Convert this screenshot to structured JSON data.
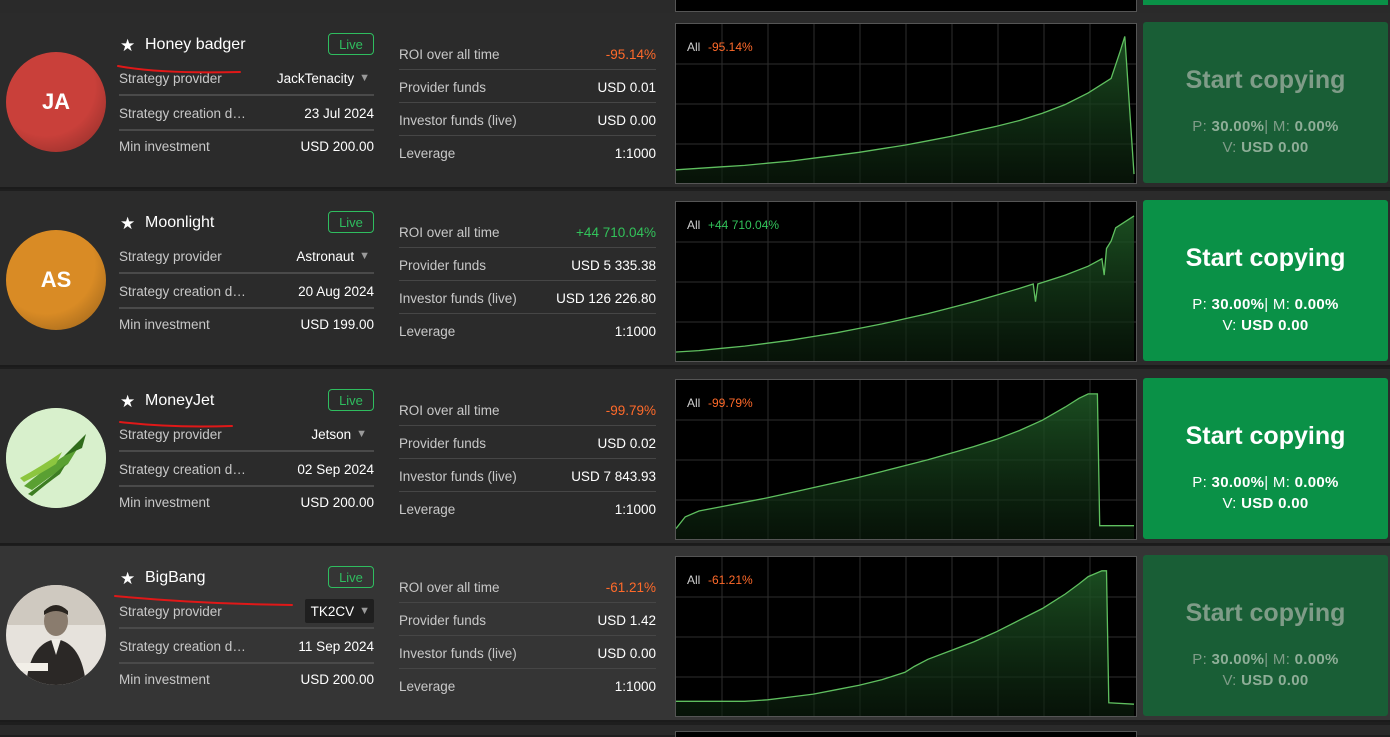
{
  "labels": {
    "strategy_provider": "Strategy provider",
    "strategy_creation": "Strategy creation date",
    "min_investment": "Min investment",
    "roi": "ROI over all time",
    "provider_funds": "Provider funds",
    "investor_funds": "Investor funds (live)",
    "leverage": "Leverage",
    "live": "Live",
    "period": "All",
    "start_copying": "Start copying",
    "p_prefix": "P:",
    "m_prefix": "| M:",
    "v_prefix": "V:"
  },
  "colors": {
    "accent_green": "#0a9147",
    "disabled_green": "#195e36",
    "positive": "#32c25a",
    "negative": "#ff6a2a",
    "live_badge": "#2fbd5f"
  },
  "strategies": [
    {
      "avatar_initials": "JA",
      "avatar_color": "#c9403a",
      "name": "Honey badger",
      "provider": "JackTenacity",
      "creation_date": "23 Jul 2024",
      "min_investment": "USD 200.00",
      "roi": "-95.14%",
      "roi_sign": "negative",
      "provider_funds": "USD 0.01",
      "investor_funds": "USD 0.00",
      "leverage": "1:1000",
      "copy_enabled": false,
      "p_value": "30.00%",
      "m_value": "0.00%",
      "v_value": "USD 0.00",
      "icon": "star-icon",
      "chart_data": {
        "type": "area",
        "x": [
          0,
          5,
          10,
          15,
          20,
          25,
          30,
          35,
          40,
          45,
          50,
          55,
          60,
          65,
          70,
          75,
          80,
          85,
          90,
          95,
          97,
          98,
          100
        ],
        "values": [
          0,
          1,
          2,
          3,
          4.5,
          6,
          8,
          10,
          12,
          14.5,
          17,
          20,
          23,
          26.5,
          30,
          34,
          39,
          45,
          53,
          63,
          82,
          92,
          -3
        ],
        "ylim": [
          -5,
          95
        ]
      }
    },
    {
      "avatar_initials": "AS",
      "avatar_color": "#d98b25",
      "name": "Moonlight",
      "provider": "Astronaut",
      "creation_date": "20 Aug 2024",
      "min_investment": "USD 199.00",
      "roi": "+44 710.04%",
      "roi_sign": "positive",
      "provider_funds": "USD 5 335.38",
      "investor_funds": "USD 126 226.80",
      "leverage": "1:1000",
      "copy_enabled": true,
      "p_value": "30.00%",
      "m_value": "0.00%",
      "v_value": "USD 0.00",
      "icon": "star-icon",
      "chart_data": {
        "type": "area",
        "x": [
          0,
          5,
          10,
          15,
          20,
          25,
          30,
          35,
          40,
          45,
          50,
          55,
          60,
          65,
          70,
          75,
          78,
          78.5,
          79,
          85,
          90,
          93,
          93.5,
          94,
          95,
          96,
          100
        ],
        "values": [
          0,
          1,
          2.5,
          4,
          6,
          8,
          10.5,
          13,
          16,
          19,
          22.5,
          26,
          30,
          34,
          38.5,
          43,
          46,
          34,
          46,
          52,
          58,
          63,
          52,
          70,
          75,
          84,
          92
        ],
        "ylim": [
          -2,
          96
        ]
      }
    },
    {
      "avatar_initials": "",
      "avatar_color": "#d6efc9",
      "name": "MoneyJet",
      "provider": "Jetson",
      "creation_date": "02 Sep 2024",
      "min_investment": "USD 200.00",
      "roi": "-99.79%",
      "roi_sign": "negative",
      "provider_funds": "USD 0.02",
      "investor_funds": "USD 7 843.93",
      "leverage": "1:1000",
      "copy_enabled": true,
      "p_value": "30.00%",
      "m_value": "0.00%",
      "v_value": "USD 0.00",
      "icon": "star-icon",
      "chart_data": {
        "type": "area",
        "x": [
          0,
          2,
          5,
          10,
          15,
          20,
          25,
          30,
          35,
          40,
          45,
          50,
          55,
          60,
          65,
          70,
          75,
          80,
          85,
          88,
          90,
          92,
          92.5,
          100
        ],
        "values": [
          0,
          8,
          12,
          15,
          18,
          21,
          24.5,
          28,
          31.5,
          35,
          39,
          43,
          47,
          51.5,
          56,
          61,
          67,
          74,
          83,
          89,
          92,
          92,
          2,
          2
        ],
        "ylim": [
          -3,
          96
        ]
      }
    },
    {
      "avatar_initials": "",
      "avatar_color": "#3a3a3a",
      "name": "BigBang",
      "provider": "TK2CV",
      "creation_date": "11 Sep 2024",
      "min_investment": "USD 200.00",
      "roi": "-61.21%",
      "roi_sign": "negative",
      "provider_funds": "USD 1.42",
      "investor_funds": "USD 0.00",
      "leverage": "1:1000",
      "copy_enabled": false,
      "p_value": "30.00%",
      "m_value": "0.00%",
      "v_value": "USD 0.00",
      "icon": "star-icon",
      "chart_data": {
        "type": "area",
        "x": [
          0,
          15,
          20,
          25,
          30,
          35,
          40,
          45,
          50,
          52,
          55,
          60,
          65,
          70,
          75,
          80,
          82,
          85,
          88,
          90,
          93,
          94,
          94.5,
          100
        ],
        "values": [
          4,
          4,
          5,
          7,
          9,
          12,
          15,
          19,
          24,
          28,
          33,
          39,
          45,
          52,
          60,
          68,
          72,
          78,
          85,
          90,
          94,
          94,
          3,
          2
        ],
        "ylim": [
          -2,
          98
        ]
      }
    }
  ]
}
